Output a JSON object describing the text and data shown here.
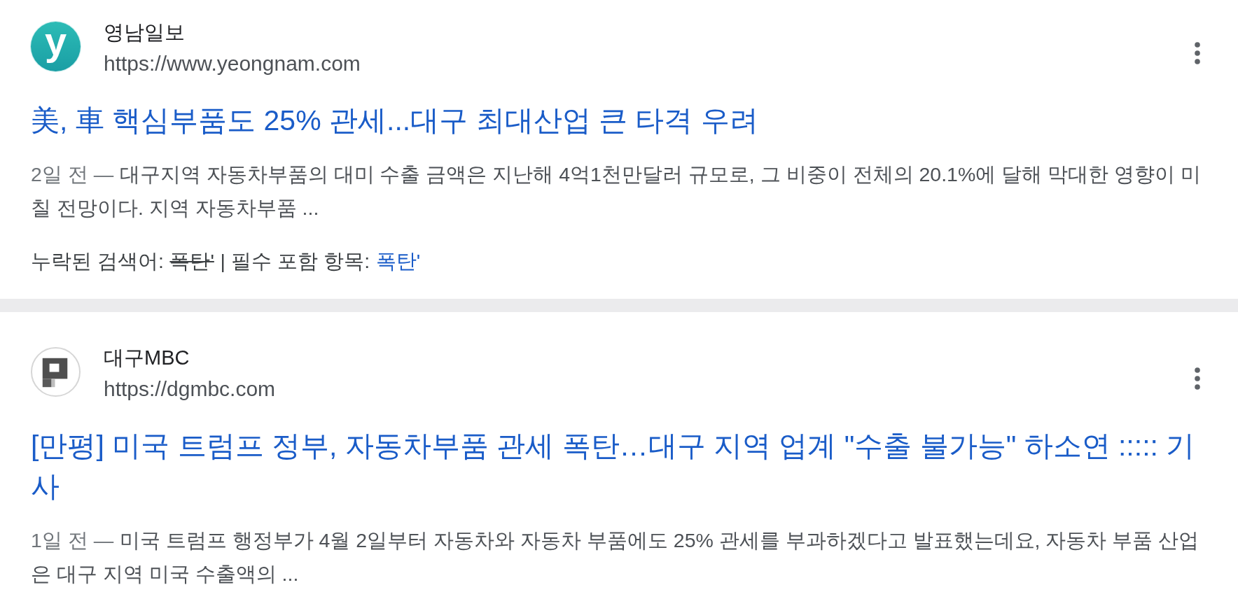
{
  "results": [
    {
      "site": {
        "name": "영남일보",
        "url": "https://www.yeongnam.com",
        "logo": {
          "kind": "letter",
          "text": "y"
        }
      },
      "title": "美, 車 핵심부품도 25% 관세...대구 최대산업 큰 타격 우려",
      "date": "2일 전 —",
      "snippet": "대구지역 자동차부품의 대미 수출 금액은 지난해 4억1천만달러 규모로, 그 비중이 전체의 20.1%에 달해 막대한 영향이 미칠 전망이다. 지역 자동차부품 ...",
      "missing_terms": {
        "label": "누락된 검색어:",
        "term": "폭탄'",
        "separator": "|",
        "required_label": "필수 포함 항목:",
        "required_term": "폭탄'"
      }
    },
    {
      "site": {
        "name": "대구MBC",
        "url": "https://dgmbc.com",
        "logo": {
          "kind": "pixel"
        }
      },
      "title": "[만평] 미국 트럼프 정부, 자동차부품 관세 폭탄…대구 지역 업계 \"수출 불가능\" 하소연 ::::: 기사",
      "date": "1일 전 —",
      "snippet": "미국 트럼프 행정부가 4월 2일부터 자동차와 자동차 부품에도 25% 관세를 부과하겠다고 발표했는데요, 자동차 부품 산업은 대구 지역 미국 수출액의 ..."
    }
  ]
}
